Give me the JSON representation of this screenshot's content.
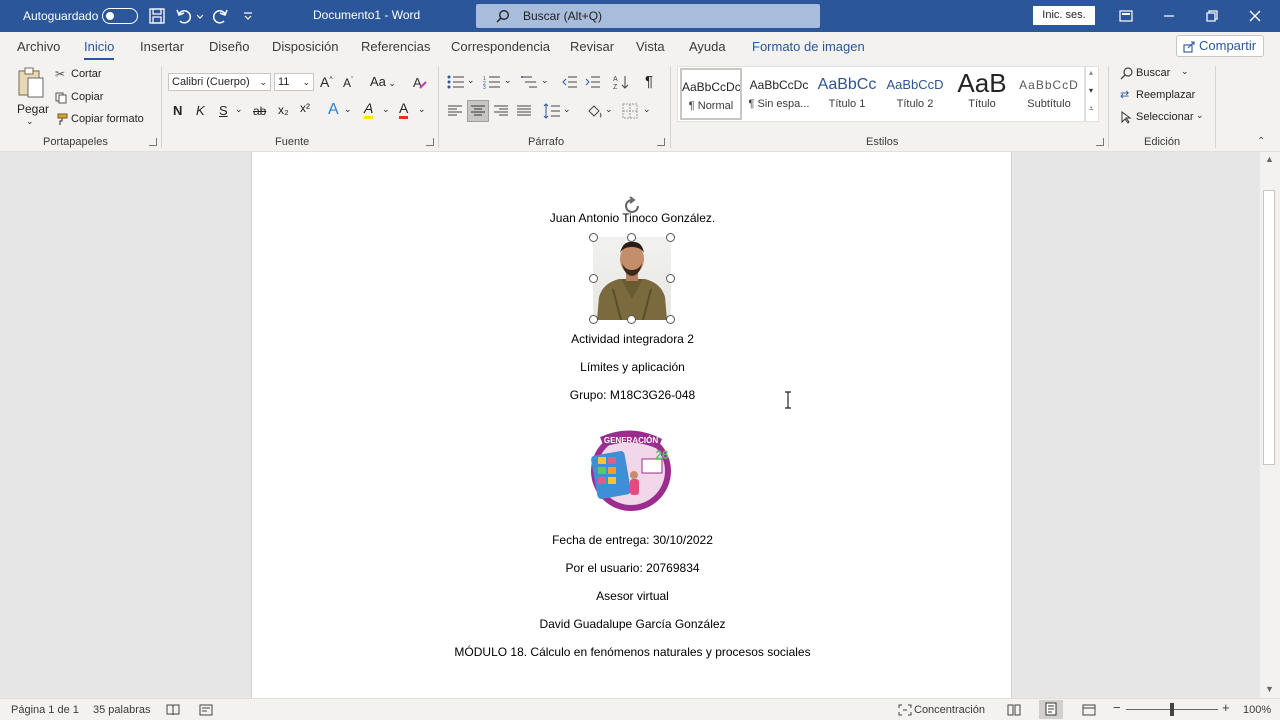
{
  "titlebar": {
    "autosave_label": "Autoguardado",
    "doc_title": "Documento1 - Word",
    "search_placeholder": "Buscar (Alt+Q)",
    "signin_label": "Inic. ses."
  },
  "tabs": [
    "Archivo",
    "Inicio",
    "Insertar",
    "Diseño",
    "Disposición",
    "Referencias",
    "Correspondencia",
    "Revisar",
    "Vista",
    "Ayuda",
    "Formato de imagen"
  ],
  "active_tab": "Inicio",
  "share_label": "Compartir",
  "ribbon": {
    "clipboard": {
      "paste": "Pegar",
      "cut": "Cortar",
      "copy": "Copiar",
      "format_painter": "Copiar formato",
      "label": "Portapapeles"
    },
    "font": {
      "font_name": "Calibri (Cuerpo)",
      "font_size": "11",
      "change_case": "Aa",
      "bold": "N",
      "italic": "K",
      "underline": "S",
      "strikethrough": "ab",
      "subscript": "x₂",
      "superscript": "x²",
      "text_effects": "A",
      "highlight": "A",
      "font_color": "A",
      "grow": "A",
      "shrink": "A",
      "label": "Fuente"
    },
    "paragraph": {
      "label": "Párrafo",
      "pilcrow": "¶"
    },
    "styles": {
      "items": [
        {
          "preview": "AaBbCcDc",
          "name": "¶ Normal"
        },
        {
          "preview": "AaBbCcDc",
          "name": "¶ Sin espa..."
        },
        {
          "preview": "AaBbCc",
          "name": "Título 1"
        },
        {
          "preview": "AaBbCcD",
          "name": "Título 2"
        },
        {
          "preview": "AaB",
          "name": "Título"
        },
        {
          "preview": "AaBbCcD",
          "name": "Subtítulo"
        }
      ],
      "label": "Estilos"
    },
    "editing": {
      "find": "Buscar",
      "replace": "Reemplazar",
      "select": "Seleccionar",
      "label": "Edición"
    }
  },
  "document": {
    "author": "Juan Antonio Tinoco González.",
    "activity": "Actividad integradora 2",
    "topic": "Límites y aplicación",
    "group": "Grupo: M18C3G26-048",
    "logo_badge_text": "GENERACIÓN",
    "logo_number": "26",
    "due_date": "Fecha de entrega: 30/10/2022",
    "user": "Por el usuario: 20769834",
    "advisor_title": "Asesor virtual",
    "advisor_name": "David Guadalupe García González",
    "module": "MÓDULO 18. Cálculo en fenómenos naturales y procesos sociales"
  },
  "status": {
    "page": "Página 1 de 1",
    "words": "35 palabras",
    "focus": "Concentración",
    "zoom": "100%"
  },
  "colors": {
    "brand": "#2b579a",
    "ribbon_bg": "#f3f2f1",
    "canvas": "#e6e6e6"
  }
}
